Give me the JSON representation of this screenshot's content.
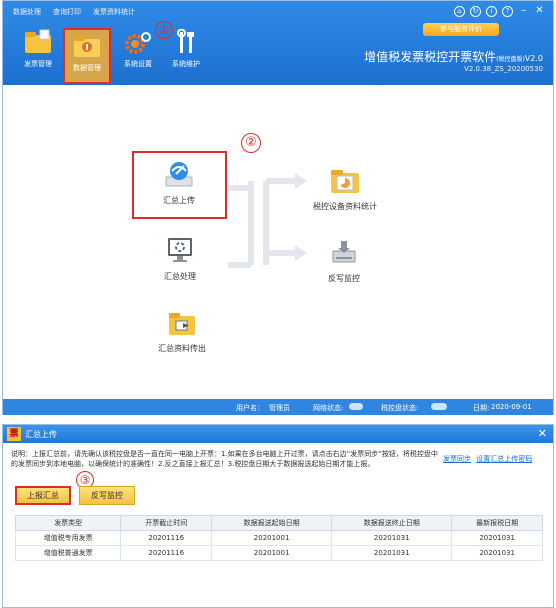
{
  "app": {
    "menu": [
      "数据处理",
      "查询打印",
      "发票资料统计"
    ],
    "feedback_button": "参与服务评价",
    "toolbar": [
      {
        "label": "发票管理",
        "icon": "invoice-folder-icon"
      },
      {
        "label": "数据管理",
        "icon": "data-folder-icon"
      },
      {
        "label": "系统设置",
        "icon": "gear-icon"
      },
      {
        "label": "系统维护",
        "icon": "wrench-icon"
      }
    ],
    "annotations": [
      "①",
      "②",
      "③"
    ],
    "title": "增值税发票税控开票软件",
    "title_suffix": "(税控盘版)",
    "title_version": "V2.0",
    "version": "V2.0.38_ZS_20200530",
    "nodes": {
      "summary_upload": "汇总上传",
      "summary_process": "汇总处理",
      "summary_export": "汇总资料传出",
      "device_stats": "税控设备资料统计",
      "writeback": "反写监控"
    },
    "status": {
      "user_label": "用户名：",
      "user_value": "管理员",
      "network_label": "网络状态:",
      "taxdisk_label": "税控盘状态:",
      "date_label": "日期:",
      "date_value": "2020-09-01"
    }
  },
  "dialog": {
    "title": "汇总上传",
    "description": "说明：上报汇总前，请先确认该税控盘是否一直在同一电脑上开票：1.如果在多台电脑上开过票，请点击右边“发票同步”按钮，将税控盘中的发票同步到本地电脑，以确保统计的准确性！2.反之直接上报汇总！3.税控盘日期大于数据报送起始日期才能上报。",
    "links": [
      "发票同步",
      "设置汇总上传密码"
    ],
    "buttons": {
      "upload": "上报汇总",
      "writeback": "反写监控"
    },
    "table": {
      "headers": [
        "发票类型",
        "开票截止时间",
        "数据报送起始日期",
        "数据报送终止日期",
        "最新报税日期"
      ],
      "rows": [
        [
          "增值税专用发票",
          "20201116",
          "20201001",
          "20201031",
          "20201031"
        ],
        [
          "增值税普通发票",
          "20201116",
          "20201001",
          "20201031",
          "20201031"
        ]
      ]
    }
  },
  "colors": {
    "brand_blue": "#1d6fd0",
    "annotation_red": "#e02b2b",
    "button_yellow": "#f5c242"
  }
}
